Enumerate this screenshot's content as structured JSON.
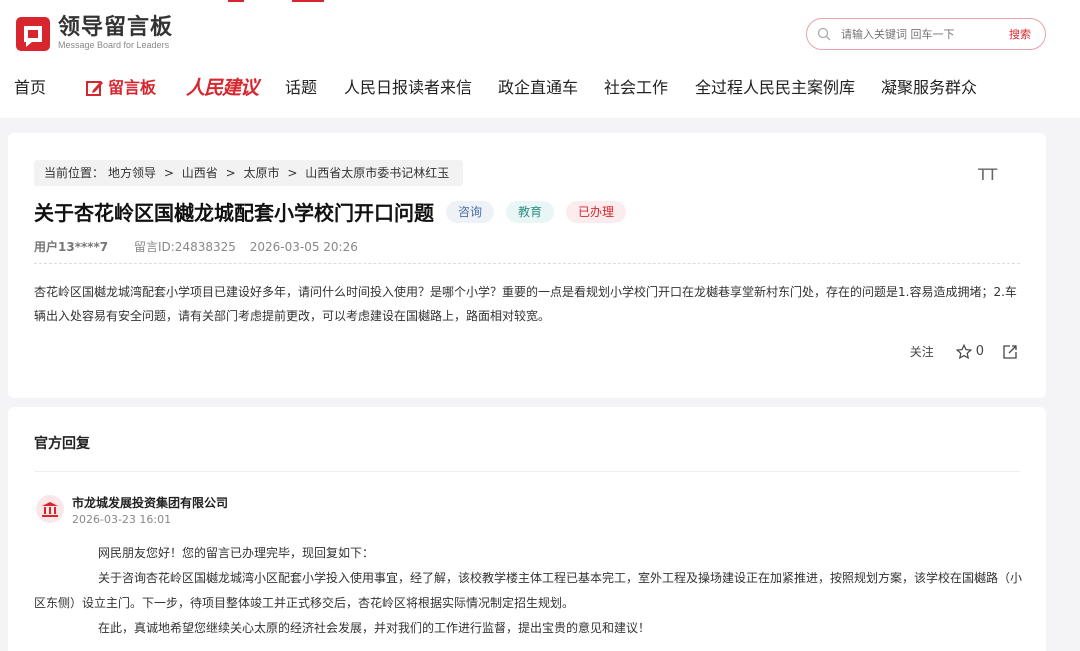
{
  "header": {
    "logo_title": "领导留言板",
    "logo_subtitle": "Message Board for Leaders",
    "search_placeholder": "请输入关键词 回车一下",
    "search_button": "搜索"
  },
  "nav": {
    "items": [
      "首页",
      "留言板",
      "人民建议",
      "话题",
      "人民日报读者来信",
      "政企直通车",
      "社会工作",
      "全过程人民民主案例库",
      "凝聚服务群众"
    ]
  },
  "message": {
    "breadcrumb": [
      "当前位置：",
      "地方领导",
      ">",
      "山西省",
      ">",
      "太原市",
      ">",
      "山西省太原市委书记林红玉"
    ],
    "font_toggle": "TT",
    "title": "关于杏花岭区国樾龙城配套小学校门开口问题",
    "tags": [
      "咨询",
      "教育",
      "已办理"
    ],
    "user": "用户13****7",
    "message_id": "留言ID:24838325",
    "date": "2026-03-05 20:26",
    "body": "杏花岭区国樾龙城湾配套小学项目已建设好多年，请问什么时间投入使用？是哪个小学？重要的一点是看规划小学校门开口在龙樾巷享堂新村东门处，存在的问题是1.容易造成拥堵；2.车辆出入处容易有安全问题，请有关部门考虑提前更改，可以考虑建设在国樾路上，路面相对较宽。",
    "follow_label": "关注",
    "star_count": "0"
  },
  "reply": {
    "section_title": "官方回复",
    "org_name": "市龙城发展投资集团有限公司",
    "date": "2026-03-23 16:01",
    "paragraphs": [
      "网民朋友您好！您的留言已办理完毕，现回复如下：",
      "关于咨询杏花岭区国樾龙城湾小区配套小学投入使用事宜，经了解，该校教学楼主体工程已基本完工，室外工程及操场建设正在加紧推进，按照规划方案，该学校在国樾路（小区东侧）设立主门。下一步，待项目整体竣工并正式移交后，杏花岭区将根据实际情况制定招生规划。",
      "在此，真诚地希望您继续关心太原的经济社会发展，并对我们的工作进行监督，提出宝贵的意见和建议！"
    ]
  },
  "colors": {
    "brand_red": "#d8262f",
    "tag_blue": "#4a6fa0",
    "tag_green": "#2f8f88"
  }
}
